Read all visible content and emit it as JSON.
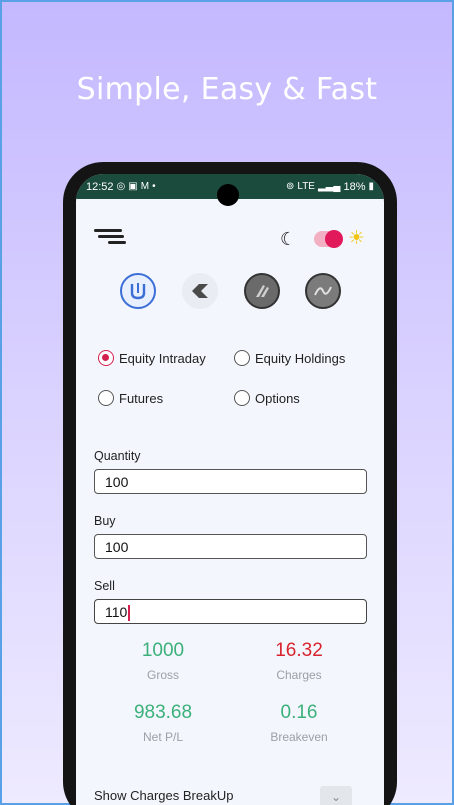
{
  "headline": "Simple, Easy & Fast",
  "status_bar": {
    "time": "12:52",
    "battery": "18%",
    "network": "LTE"
  },
  "broker_icons": [
    "upstox-icon",
    "kite-icon",
    "angel-icon",
    "groww-icon"
  ],
  "segments": [
    {
      "label": "Equity Intraday",
      "selected": true
    },
    {
      "label": "Equity Holdings",
      "selected": false
    },
    {
      "label": "Futures",
      "selected": false
    },
    {
      "label": "Options",
      "selected": false
    }
  ],
  "fields": {
    "quantity_label": "Quantity",
    "quantity_value": "100",
    "buy_label": "Buy",
    "buy_value": "100",
    "sell_label": "Sell",
    "sell_value": "110"
  },
  "results": {
    "gross_value": "1000",
    "gross_label": "Gross",
    "charges_value": "16.32",
    "charges_label": "Charges",
    "net_value": "983.68",
    "net_label": "Net P/L",
    "breakeven_value": "0.16",
    "breakeven_label": "Breakeven"
  },
  "breakup_label": "Show Charges BreakUp",
  "colors": {
    "accent": "#d4204f",
    "positive": "#3cb07a",
    "negative": "#d8242e",
    "status_bar": "#1b4b3c"
  }
}
